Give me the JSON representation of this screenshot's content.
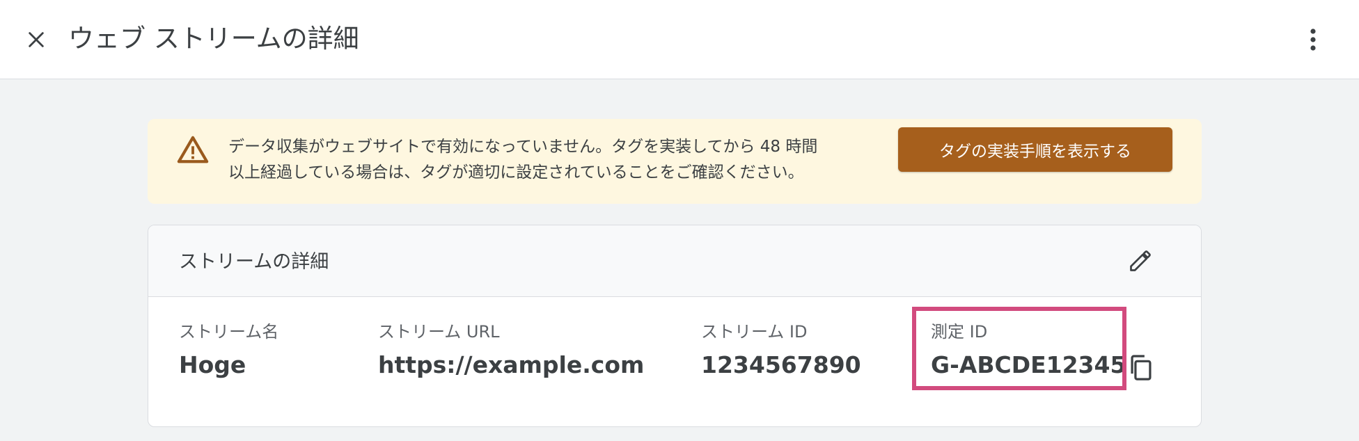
{
  "header": {
    "title": "ウェブ ストリームの詳細",
    "close_icon": "close-icon",
    "more_icon": "more-vert-icon"
  },
  "banner": {
    "icon": "warning-icon",
    "line1": "データ収集がウェブサイトで有効になっていません。タグを実装してから 48 時間",
    "line2": "以上経過している場合は、タグが適切に設定されていることをご確認ください。",
    "button_label": "タグの実装手順を表示する",
    "accent_color": "#a65f1c",
    "background_color": "#fef7e0"
  },
  "card": {
    "title": "ストリームの詳細",
    "edit_icon": "pencil-icon",
    "copy_icon": "copy-icon",
    "fields": [
      {
        "label": "ストリーム名",
        "value": "Hoge"
      },
      {
        "label": "ストリーム URL",
        "value": "https://example.com"
      },
      {
        "label": "ストリーム ID",
        "value": "1234567890"
      },
      {
        "label": "測定 ID",
        "value": "G-ABCDE12345"
      }
    ],
    "highlight_color": "#d24b7e"
  }
}
